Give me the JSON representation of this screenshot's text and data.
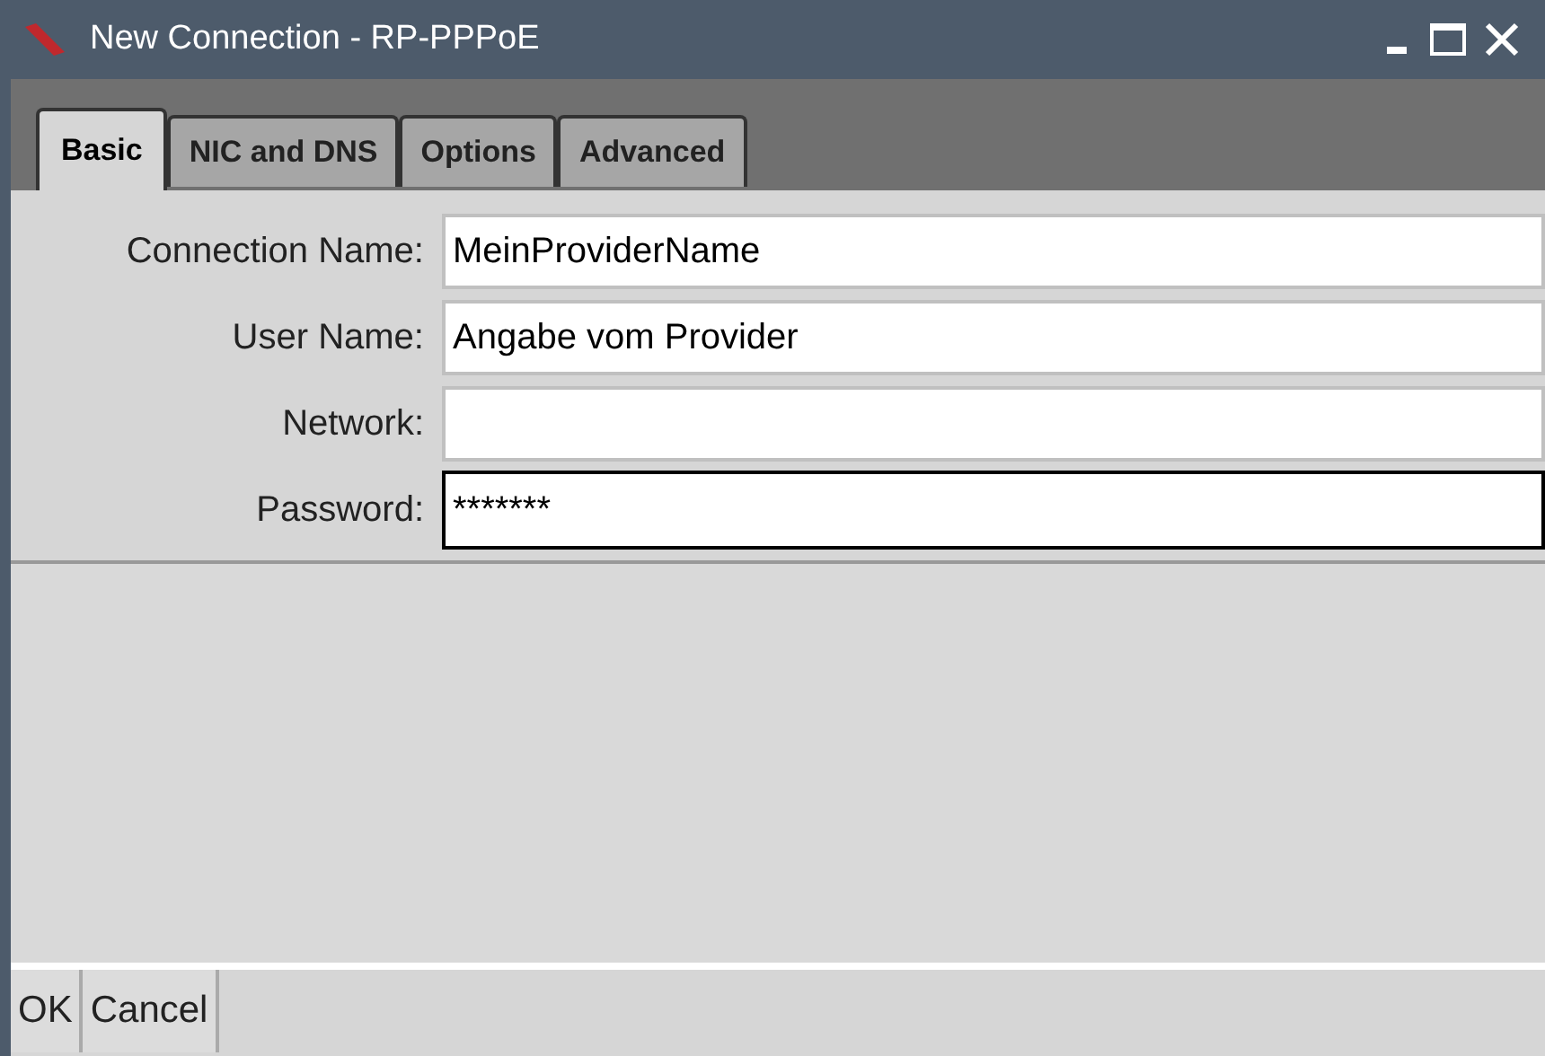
{
  "window": {
    "title": "New Connection - RP-PPPoE"
  },
  "tabs": [
    {
      "label": "Basic",
      "selected": true
    },
    {
      "label": "NIC and DNS",
      "selected": false
    },
    {
      "label": "Options",
      "selected": false
    },
    {
      "label": "Advanced",
      "selected": false
    }
  ],
  "fields": [
    {
      "label": "Connection Name:",
      "value": "MeinProviderName",
      "focused": false
    },
    {
      "label": "User Name:",
      "value": "Angabe vom Provider",
      "focused": false
    },
    {
      "label": "Network:",
      "focused": false
    },
    {
      "label": "Password:",
      "value": "*******",
      "focused": true
    }
  ],
  "buttons": [
    "OK",
    "Cancel"
  ]
}
